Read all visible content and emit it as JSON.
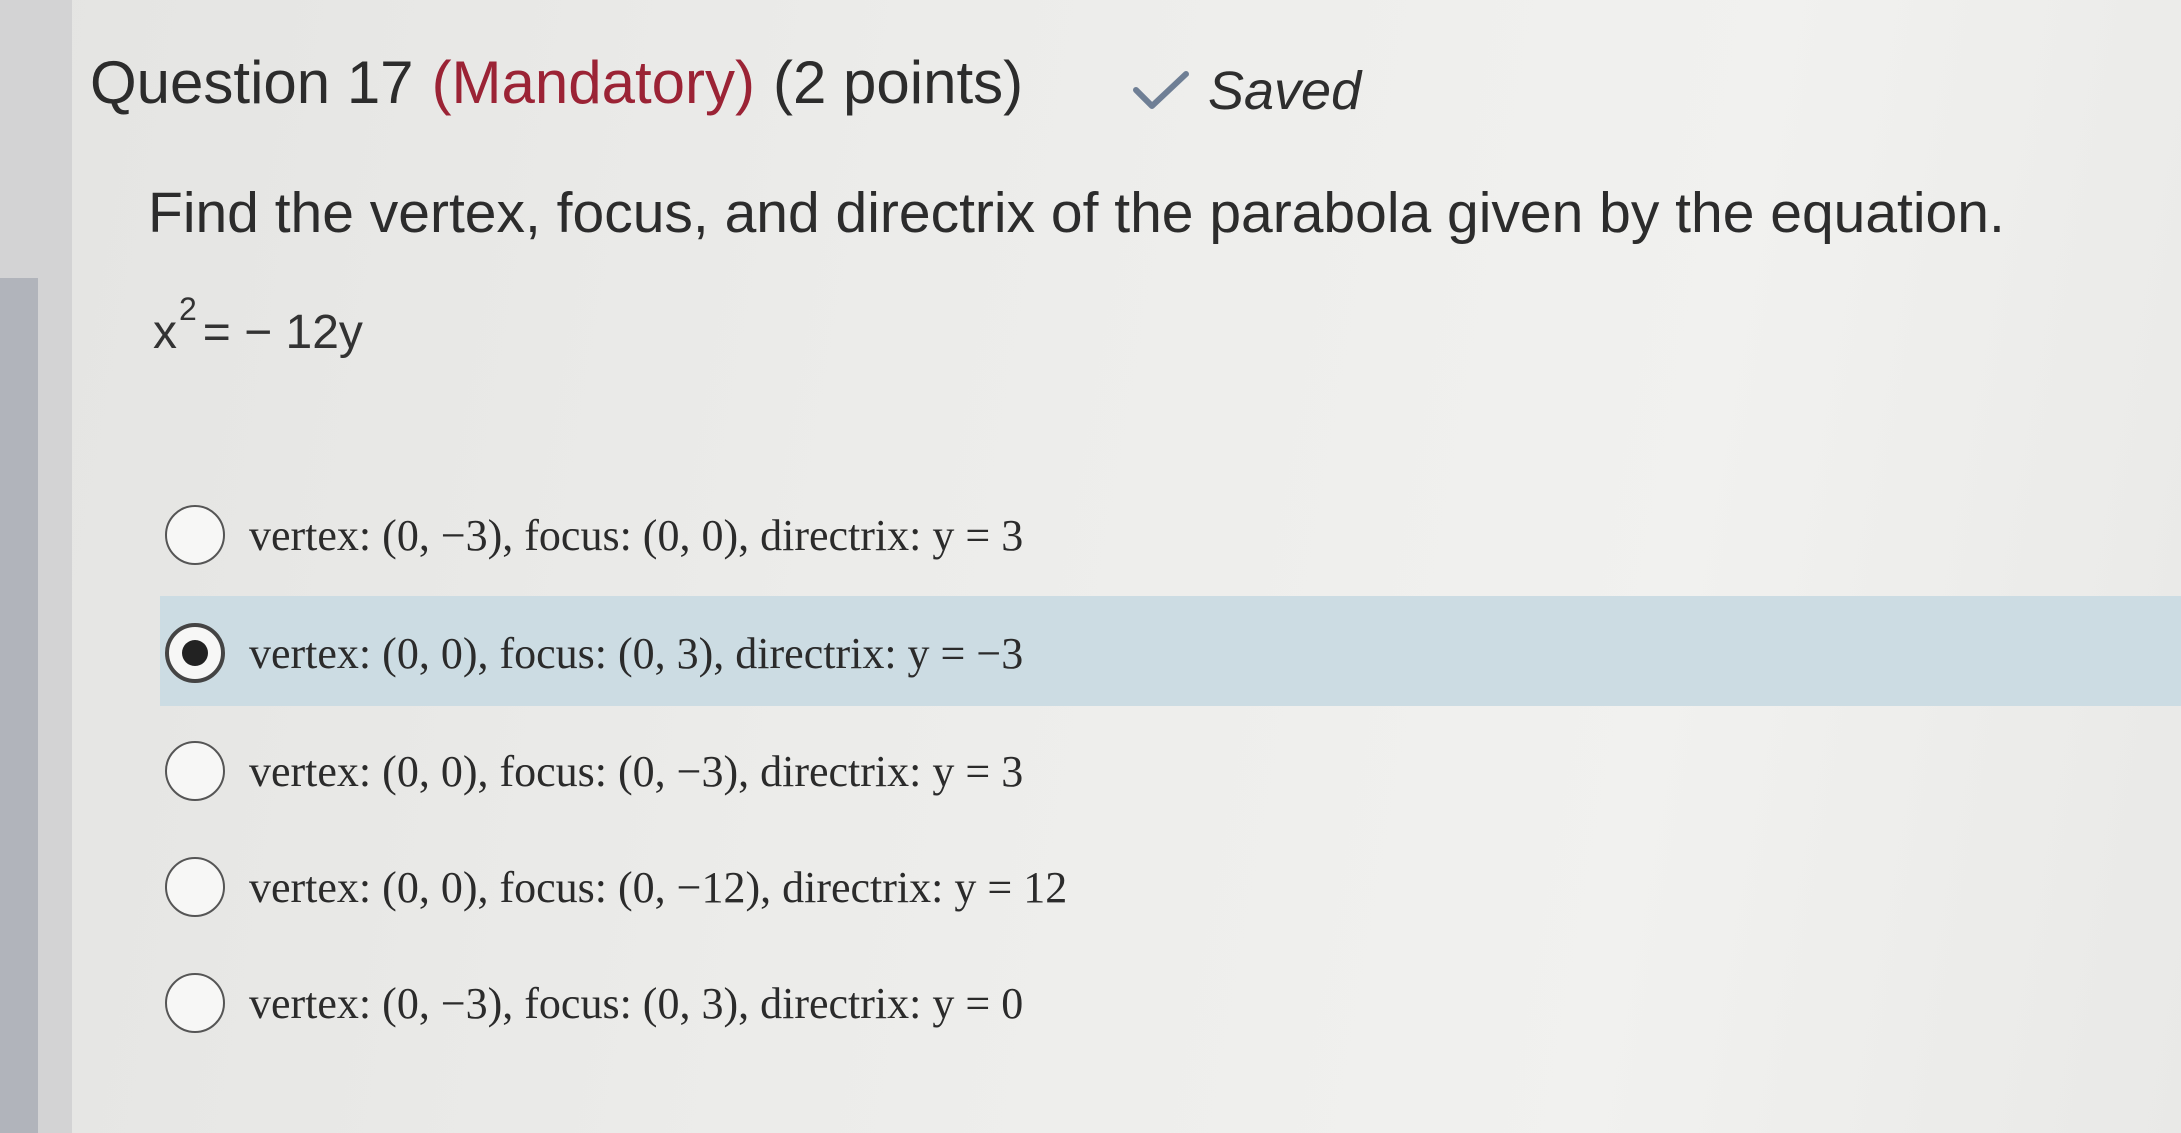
{
  "question": {
    "title": "Question 17",
    "mandatory": "(Mandatory)",
    "points": "(2 points)",
    "saved_label": "Saved",
    "prompt": "Find the vertex, focus, and directrix of the parabola given by the equation.",
    "equation": {
      "base": "x",
      "exponent": "2",
      "rest": "= − 12y"
    }
  },
  "options": [
    {
      "label": "vertex: (0, −3), focus: (0, 0), directrix: y = 3",
      "selected": false
    },
    {
      "label": "vertex: (0, 0), focus: (0, 3), directrix: y = −3",
      "selected": true
    },
    {
      "label": "vertex: (0, 0), focus: (0, −3), directrix: y = 3",
      "selected": false
    },
    {
      "label": "vertex: (0, 0), focus: (0, −12), directrix: y = 12",
      "selected": false
    },
    {
      "label": "vertex: (0, −3), focus: (0, 3), directrix: y = 0",
      "selected": false
    }
  ],
  "icons": {
    "saved": "check-icon"
  },
  "colors": {
    "mandatory": "#9b2335",
    "saved_check": "#6f7f95",
    "selected_highlight": "#ccdce3"
  }
}
